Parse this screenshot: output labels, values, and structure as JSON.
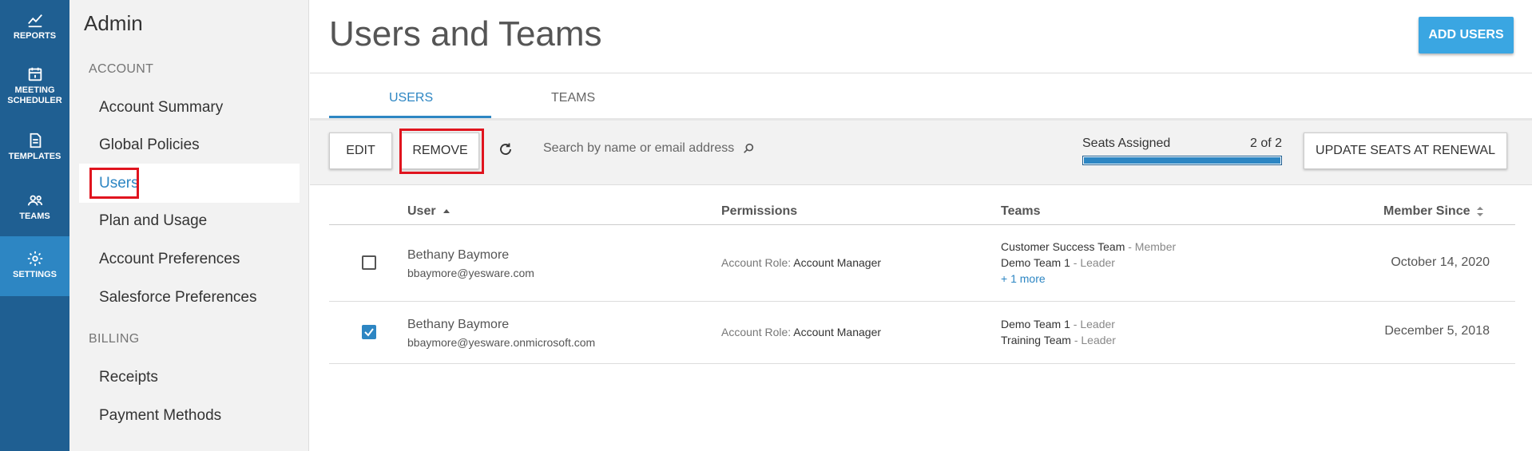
{
  "rail": {
    "reports": "REPORTS",
    "meeting_line1": "MEETING",
    "meeting_line2": "SCHEDULER",
    "templates": "TEMPLATES",
    "teams": "TEAMS",
    "settings": "SETTINGS"
  },
  "sidebar": {
    "title": "Admin",
    "account_section": "ACCOUNT",
    "account_items": [
      "Account Summary",
      "Global Policies",
      "Users",
      "Plan and Usage",
      "Account Preferences",
      "Salesforce Preferences"
    ],
    "billing_section": "BILLING",
    "billing_items": [
      "Receipts",
      "Payment Methods"
    ]
  },
  "header": {
    "title": "Users and Teams",
    "add_users_label": "ADD USERS"
  },
  "tabs": [
    {
      "label": "USERS"
    },
    {
      "label": "TEAMS"
    }
  ],
  "toolbar": {
    "edit_label": "EDIT",
    "remove_label": "REMOVE",
    "search_placeholder": "Search by name or email address",
    "seats_label": "Seats Assigned",
    "seats_count": "2 of 2",
    "seats_fraction": 1.0,
    "update_seats_label": "UPDATE SEATS AT RENEWAL"
  },
  "table": {
    "columns": {
      "user": "User",
      "permissions": "Permissions",
      "teams": "Teams",
      "member_since": "Member Since"
    },
    "rows": [
      {
        "name": "Bethany Baymore",
        "email": "bbaymore@yesware.com",
        "checked": false,
        "perm_label": "Account Role:",
        "perm_value": "Account Manager",
        "teams": [
          {
            "name": "Customer Success Team",
            "role": "- Member"
          },
          {
            "name": "Demo Team 1",
            "role": "- Leader"
          }
        ],
        "more": "+ 1 more",
        "since": "October 14, 2020"
      },
      {
        "name": "Bethany Baymore",
        "email": "bbaymore@yesware.onmicrosoft.com",
        "checked": true,
        "perm_label": "Account Role:",
        "perm_value": "Account Manager",
        "teams": [
          {
            "name": "Demo Team 1",
            "role": "- Leader"
          },
          {
            "name": "Training Team",
            "role": "- Leader"
          }
        ],
        "since": "December 5, 2018"
      }
    ]
  },
  "colors": {
    "rail": "#1f5f92",
    "rail_active": "#2d86c3",
    "accent": "#2d86c3",
    "add_button": "#3aa6e2",
    "highlight_box": "#e0141e"
  }
}
